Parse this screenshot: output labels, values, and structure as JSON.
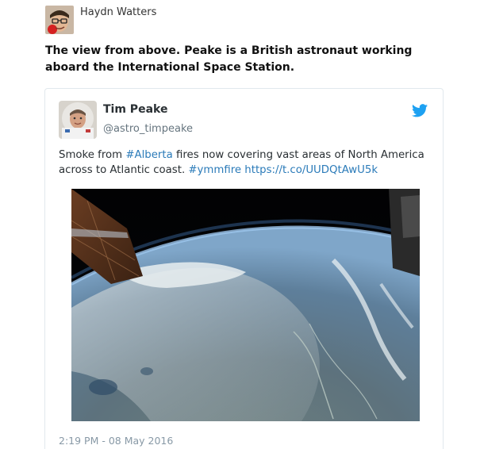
{
  "post": {
    "author_name": "Haydn Watters",
    "intro_text": "The view from above. Peake is a British astronaut working aboard the International Space Station."
  },
  "tweet": {
    "display_name": "Tim Peake",
    "handle": "@astro_timpeake",
    "text_part1": "Smoke from ",
    "hashtag1": "#Alberta",
    "text_part2": " fires now covering vast areas of North America across to Atlantic coast. ",
    "hashtag2": "#ymmfire",
    "text_part3": " ",
    "link": "https://t.co/UUDQtAwU5k",
    "timestamp": "2:19 PM - 08 May 2016",
    "icons": {
      "brand": "twitter-bird-icon"
    },
    "colors": {
      "link": "#2b7bb9",
      "brand": "#1da1f2"
    }
  }
}
